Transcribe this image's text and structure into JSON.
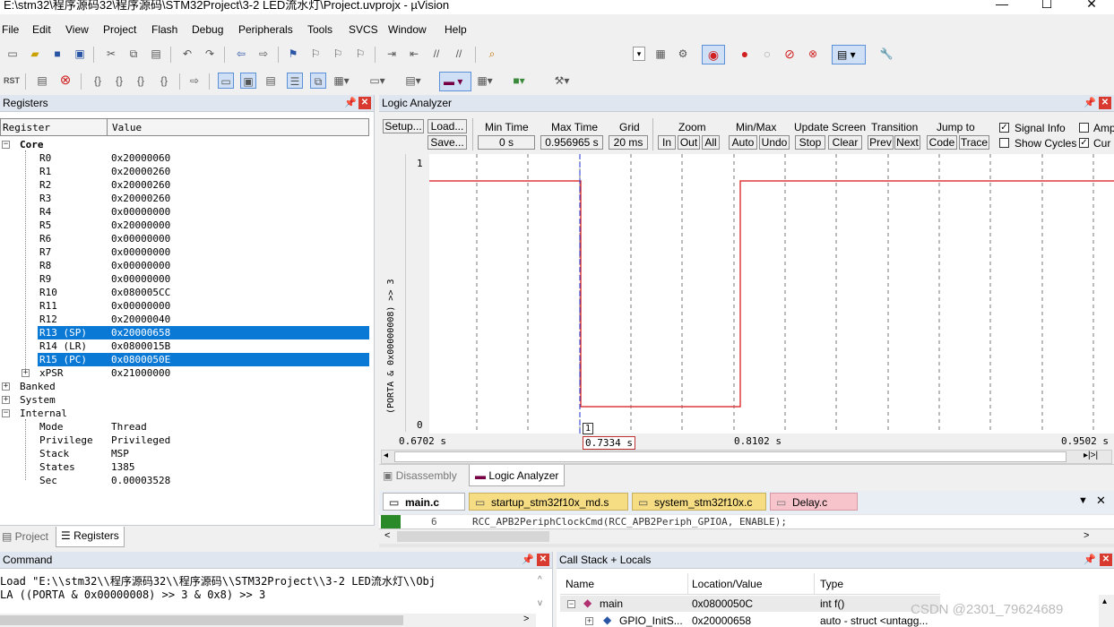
{
  "window": {
    "title": "E:\\stm32\\程序源码32\\程序源码\\STM32Project\\3-2 LED流水灯\\Project.uvprojx - µVision",
    "min": "—",
    "max": "☐",
    "close": "✕"
  },
  "menu": [
    "File",
    "Edit",
    "View",
    "Project",
    "Flash",
    "Debug",
    "Peripherals",
    "Tools",
    "SVCS",
    "Window",
    "Help"
  ],
  "registers": {
    "title": "Registers",
    "col_register": "Register",
    "col_value": "Value",
    "core_label": "Core",
    "rows": [
      {
        "name": "R0",
        "value": "0x20000060"
      },
      {
        "name": "R1",
        "value": "0x20000260"
      },
      {
        "name": "R2",
        "value": "0x20000260"
      },
      {
        "name": "R3",
        "value": "0x20000260"
      },
      {
        "name": "R4",
        "value": "0x00000000"
      },
      {
        "name": "R5",
        "value": "0x20000000"
      },
      {
        "name": "R6",
        "value": "0x00000000"
      },
      {
        "name": "R7",
        "value": "0x00000000"
      },
      {
        "name": "R8",
        "value": "0x00000000"
      },
      {
        "name": "R9",
        "value": "0x00000000"
      },
      {
        "name": "R10",
        "value": "0x080005CC"
      },
      {
        "name": "R11",
        "value": "0x00000000"
      },
      {
        "name": "R12",
        "value": "0x20000040"
      },
      {
        "name": "R13 (SP)",
        "value": "0x20000658"
      },
      {
        "name": "R14 (LR)",
        "value": "0x0800015B"
      },
      {
        "name": "R15 (PC)",
        "value": "0x0800050E"
      },
      {
        "name": "xPSR",
        "value": "0x21000000"
      }
    ],
    "banked": "Banked",
    "system": "System",
    "internal": "Internal",
    "internal_rows": [
      {
        "name": "Mode",
        "value": "Thread"
      },
      {
        "name": "Privilege",
        "value": "Privileged"
      },
      {
        "name": "Stack",
        "value": "MSP"
      },
      {
        "name": "States",
        "value": "1385"
      },
      {
        "name": "Sec",
        "value": "0.00003528"
      }
    ],
    "tab_project": "Project",
    "tab_registers": "Registers"
  },
  "logic": {
    "title": "Logic Analyzer",
    "setup": "Setup...",
    "load": "Load...",
    "save": "Save...",
    "min_time_label": "Min Time",
    "min_time": "0 s",
    "max_time_label": "Max Time",
    "max_time": "0.956965 s",
    "grid_label": "Grid",
    "grid": "20 ms",
    "zoom_label": "Zoom",
    "zoom_in": "In",
    "zoom_out": "Out",
    "zoom_all": "All",
    "minmax_label": "Min/Max",
    "auto": "Auto",
    "undo": "Undo",
    "update_label": "Update Screen",
    "stop": "Stop",
    "clear": "Clear",
    "transition_label": "Transition",
    "prev": "Prev",
    "next": "Next",
    "jump_label": "Jump to",
    "code": "Code",
    "trace": "Trace",
    "signal_info": "Signal Info",
    "show_cycles": "Show Cycles",
    "amp": "Amp",
    "cur": "Cur",
    "signal_name": "(PORTA & 0x00000008) >> 3",
    "y_top": "1",
    "y_bottom": "0",
    "x_left": "0.6702 s",
    "x_cursor": "0.7334 s",
    "x_mid": "0.8102 s",
    "x_right": "0.9502 s",
    "cursor_marker": "1",
    "signal_color": "#e03a3a",
    "cursor_color": "#2030d0"
  },
  "view_tabs": {
    "disassembly": "Disassembly",
    "logic": "Logic Analyzer"
  },
  "editor": {
    "tabs": [
      {
        "label": "main.c",
        "active": true
      },
      {
        "label": "startup_stm32f10x_md.s",
        "active": false
      },
      {
        "label": "system_stm32f10x.c",
        "active": false
      },
      {
        "label": "Delay.c",
        "active": false
      }
    ],
    "line_no": "6",
    "line_code": "RCC_APB2PeriphClockCmd(RCC_APB2Periph_GPIOA, ENABLE);"
  },
  "command": {
    "title": "Command",
    "line1": "Load \"E:\\\\stm32\\\\程序源码32\\\\程序源码\\\\STM32Project\\\\3-2 LED流水灯\\\\Obj",
    "line2": "LA ((PORTA & 0x00000008) >> 3 & 0x8) >> 3"
  },
  "callstack": {
    "title": "Call Stack + Locals",
    "col_name": "Name",
    "col_loc": "Location/Value",
    "col_type": "Type",
    "rows": [
      {
        "name": "main",
        "loc": "0x0800050C",
        "type": "int f()"
      },
      {
        "name": "GPIO_InitS...",
        "loc": "0x20000658",
        "type": "auto - struct <untagg..."
      }
    ]
  },
  "watermark": "CSDN @2301_79624689"
}
